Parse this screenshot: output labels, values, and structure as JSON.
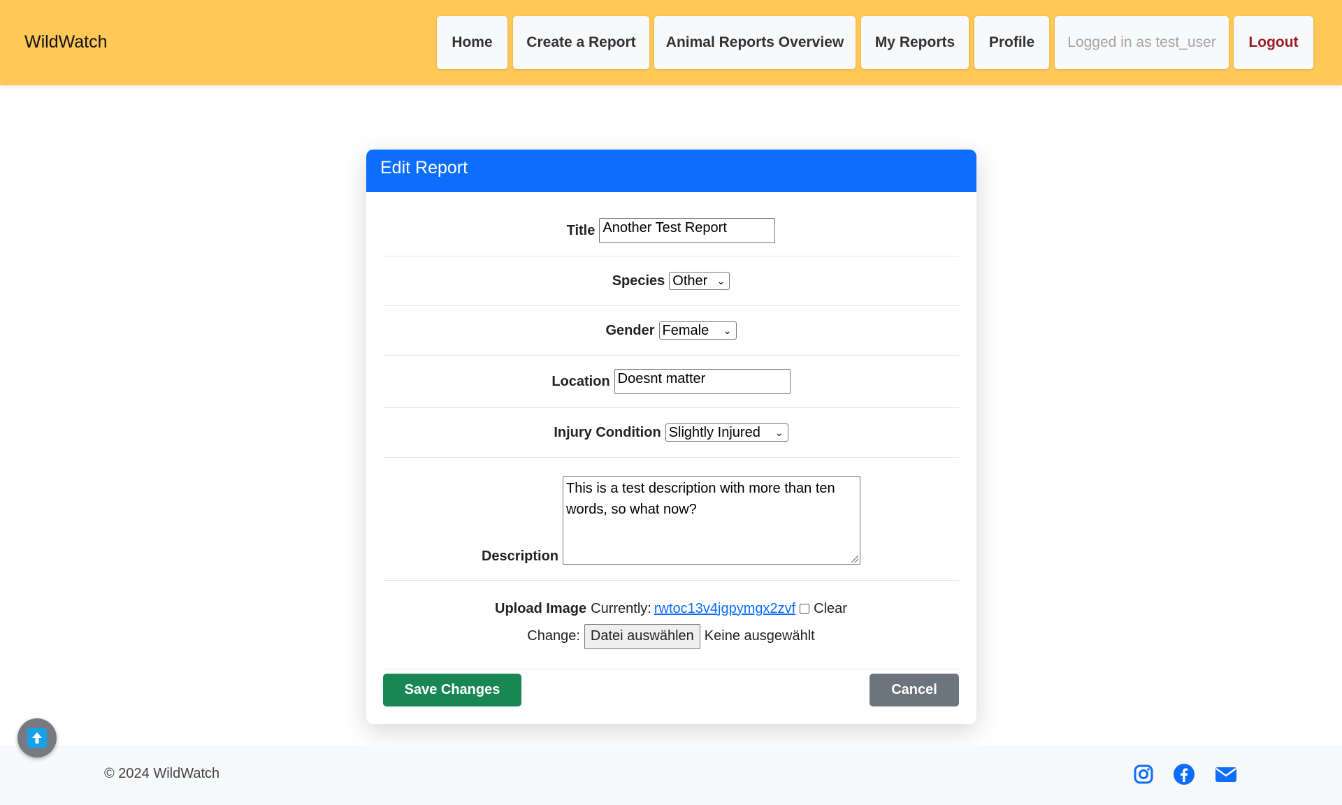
{
  "brand": "WildWatch",
  "nav": {
    "home": "Home",
    "create": "Create a Report",
    "overview": "Animal Reports Overview",
    "my_reports": "My Reports",
    "profile": "Profile",
    "logged_in": "Logged in as test_user",
    "logout": "Logout"
  },
  "form": {
    "header": "Edit Report",
    "title_label": "Title",
    "title_value": "Another Test Report",
    "species_label": "Species",
    "species_value": "Other",
    "gender_label": "Gender",
    "gender_value": "Female",
    "location_label": "Location",
    "location_value": "Doesnt matter",
    "injury_label": "Injury Condition",
    "injury_value": "Slightly Injured",
    "description_label": "Description",
    "description_value": "This is a test description with more than ten words, so what now?",
    "upload_label": "Upload Image",
    "currently_label": "Currently:",
    "current_file": "rwtoc13v4jgpymgx2zvf",
    "clear_label": "Clear",
    "change_label": "Change:",
    "choose_file": "Datei auswählen",
    "no_file": "Keine ausgewählt",
    "save": "Save Changes",
    "cancel": "Cancel"
  },
  "footer": {
    "copyright": "© 2024 WildWatch",
    "icons": [
      "instagram-icon",
      "facebook-icon",
      "email-icon"
    ]
  },
  "colors": {
    "navbar": "#ffc857",
    "primary": "#0d6efd",
    "success": "#198754",
    "secondary": "#6c757d",
    "logout": "#9c1c26"
  }
}
